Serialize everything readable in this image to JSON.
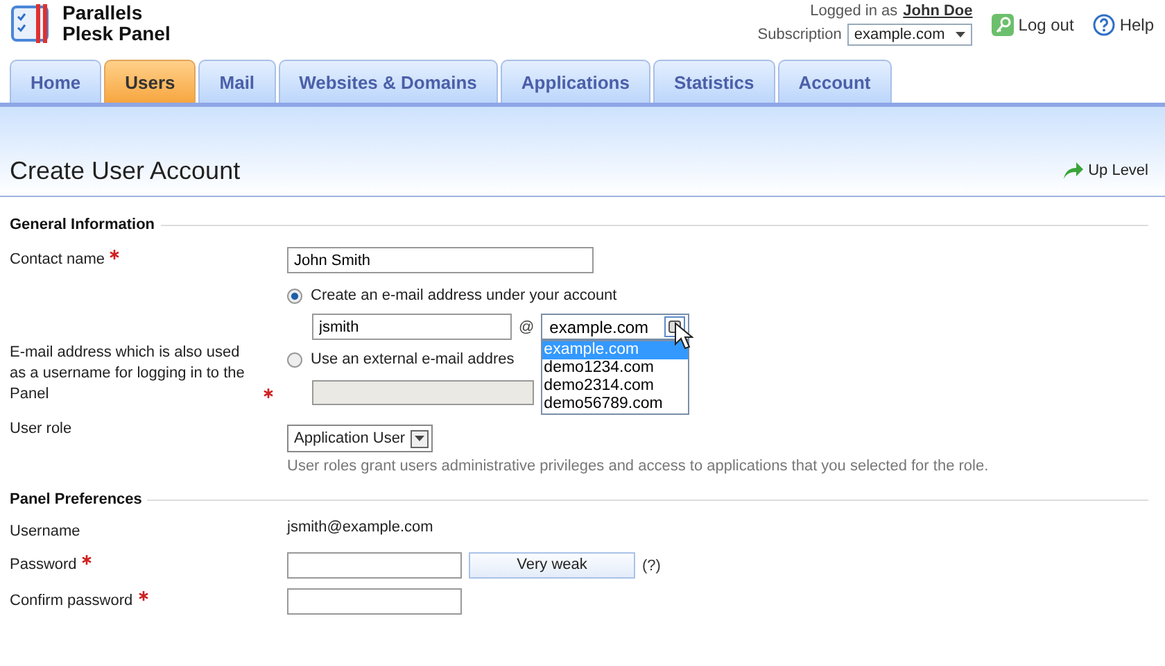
{
  "brand": {
    "line_1": "Parallels",
    "line_2": "Plesk Panel"
  },
  "account": {
    "logged_in_label": "Logged in as",
    "user": "John Doe",
    "subscription_label": "Subscription",
    "subscription": "example.com",
    "logout": "Log out",
    "help": "Help"
  },
  "tabs": [
    {
      "label": "Home",
      "selected": false
    },
    {
      "label": "Users",
      "selected": true
    },
    {
      "label": "Mail",
      "selected": false
    },
    {
      "label": "Websites & Domains",
      "selected": false
    },
    {
      "label": "Applications",
      "selected": false
    },
    {
      "label": "Statistics",
      "selected": false
    },
    {
      "label": "Account",
      "selected": false
    }
  ],
  "page": {
    "title": "Create User Account",
    "up_level": "Up Level"
  },
  "general": {
    "heading": "General Information",
    "contact_name": {
      "label": "Contact name",
      "required": true,
      "value": "John Smith"
    },
    "email": {
      "label": "E-mail address which is also used as a username for logging in to the Panel",
      "required": true,
      "options": [
        {
          "label": "Create an e-mail address under your account",
          "selected": true
        },
        {
          "label": "Use an external e-mail addres",
          "selected": false
        }
      ],
      "mailbox": "jsmith",
      "at": "@",
      "domain": "example.com",
      "domain_list": [
        {
          "label": "example.com",
          "selected": true
        },
        {
          "label": "demo1234.com",
          "selected": false
        },
        {
          "label": "demo2314.com",
          "selected": false
        },
        {
          "label": "demo56789.com",
          "selected": false
        }
      ]
    },
    "user_role": {
      "label": "User role",
      "value": "Application User",
      "hint": "User roles grant users administrative privileges and access to applications that you selected for the role."
    }
  },
  "preferences": {
    "heading": "Panel Preferences",
    "username": {
      "label": "Username",
      "value": "jsmith@example.com"
    },
    "password": {
      "label": "Password",
      "required": true,
      "strength": "Very weak",
      "help": "(?)"
    },
    "confirm": {
      "label": "Confirm password",
      "required": true
    }
  }
}
